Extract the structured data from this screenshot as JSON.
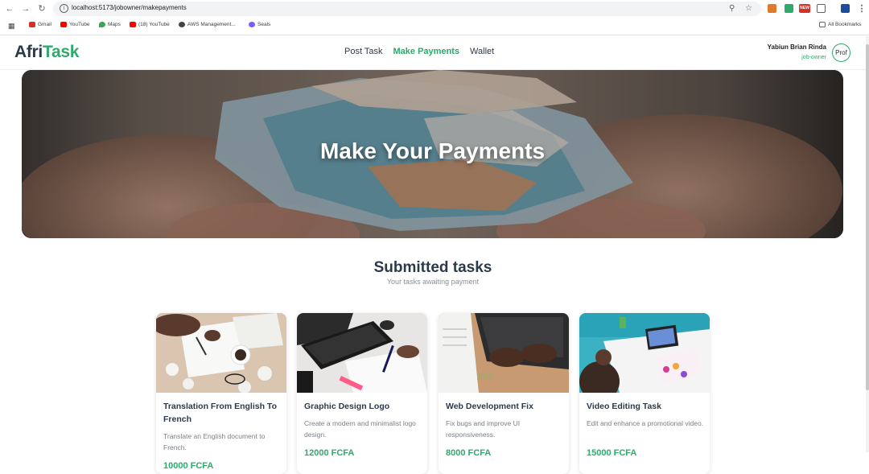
{
  "browser": {
    "url": "localhost:5173/jobowner/makepayments",
    "bookmarks": [
      {
        "label": "Gmail",
        "color": "#d93025"
      },
      {
        "label": "YouTube",
        "color": "#ff0000"
      },
      {
        "label": "Maps",
        "color": "#34a853"
      },
      {
        "label": "(18) YouTube",
        "color": "#ff0000"
      },
      {
        "label": "AWS Management...",
        "color": "#444444"
      },
      {
        "label": "Seals",
        "color": "#7b5cff"
      }
    ],
    "all_bookmarks": "All Bookmarks",
    "new_badge": "NEW"
  },
  "header": {
    "logo_part1": "Afri",
    "logo_part2": "Task",
    "nav": [
      {
        "label": "Post Task",
        "active": false
      },
      {
        "label": "Make Payments",
        "active": true
      },
      {
        "label": "Wallet",
        "active": false
      }
    ],
    "user_name": "Yabiun Brian Rinda",
    "user_role": "job-owner",
    "avatar_alt": "Prof"
  },
  "hero": {
    "title": "Make Your Payments"
  },
  "section": {
    "title": "Submitted tasks",
    "subtitle": "Your tasks awaiting payment"
  },
  "tasks": [
    {
      "title": "Translation From English To French",
      "description": "Translate an English document to French.",
      "price": "10000 FCFA",
      "image": "hands-writing-paper-coffee"
    },
    {
      "title": "Graphic Design Logo",
      "description": "Create a modern and minimalist logo design.",
      "price": "12000 FCFA",
      "image": "keyboard-sketch-pen"
    },
    {
      "title": "Web Development Fix",
      "description": "Fix bugs and improve UI responsiveness.",
      "price": "8000 FCFA",
      "image": "hands-typing-laptop"
    },
    {
      "title": "Video Editing Task",
      "description": "Edit and enhance a promotional video.",
      "price": "15000 FCFA",
      "image": "person-laptop-desk"
    }
  ],
  "colors": {
    "brand_green": "#2eaa6b",
    "dark_text": "#2b3a4a"
  }
}
